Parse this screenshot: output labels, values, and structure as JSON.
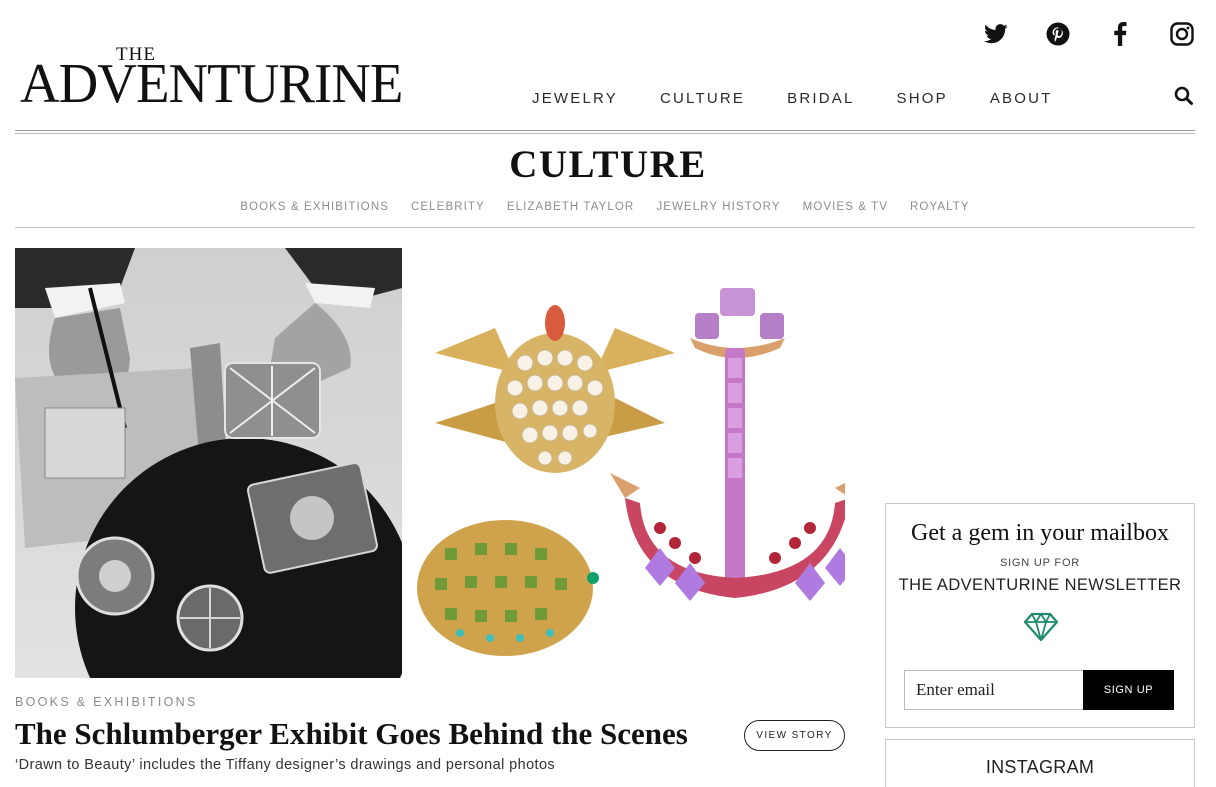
{
  "site": {
    "logo_small": "THE",
    "logo_main": "ADVENTURINE"
  },
  "social": [
    "twitter-icon",
    "pinterest-icon",
    "facebook-icon",
    "instagram-icon"
  ],
  "nav": {
    "items": [
      "JEWELRY",
      "CULTURE",
      "BRIDAL",
      "SHOP",
      "ABOUT"
    ]
  },
  "section": {
    "title": "CULTURE",
    "subnav": [
      "BOOKS & EXHIBITIONS",
      "CELEBRITY",
      "ELIZABETH TAYLOR",
      "JEWELRY HISTORY",
      "MOVIES & TV",
      "ROYALTY"
    ]
  },
  "feature": {
    "category": "BOOKS & EXHIBITIONS",
    "headline": "The Schlumberger Exhibit Goes Behind the Scenes",
    "dek": "‘Drawn to Beauty’ includes the Tiffany designer’s drawings and personal photos",
    "button": "VIEW STORY"
  },
  "newsletter": {
    "title": "Get a gem in your mailbox",
    "kicker": "SIGN UP FOR",
    "name": "THE ADVENTURINE NEWSLETTER",
    "placeholder": "Enter email",
    "button": "SIGN UP",
    "accent": "#1e8a6e"
  },
  "instagram": {
    "title": "INSTAGRAM"
  }
}
